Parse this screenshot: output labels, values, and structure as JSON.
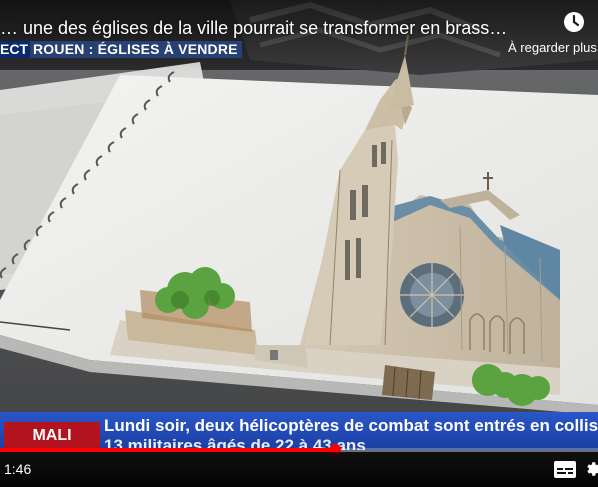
{
  "video": {
    "title": "… une des églises de la ville pourrait se transformer en brass…",
    "watch_later_label": "À regarder plus tard",
    "watch_later_icon": "clock-icon"
  },
  "chyron": {
    "live_label": "ECT",
    "headline": "ROUEN : ÉGLISES À VENDRE"
  },
  "ticker": {
    "tag": "MALI",
    "line1": "Lundi soir, deux hélicoptères de combat sont entrés en collision, tuant",
    "line2": "13 militaires âgés de 22 à 43 ans",
    "tag_color": "#b3121f",
    "band_color": "#2a56c9"
  },
  "player": {
    "current_time": "1:46",
    "progress": 0.56,
    "accent_color": "#ff0000",
    "captions_icon": "captions-icon",
    "settings_icon": "gear-icon"
  }
}
